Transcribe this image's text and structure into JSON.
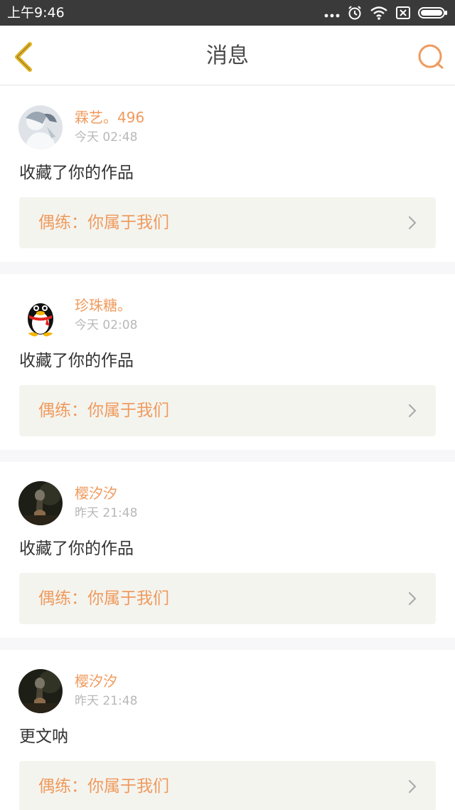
{
  "status_bar": {
    "time": "上午9:46",
    "icons": [
      "more-dots-icon",
      "alarm-icon",
      "wifi-icon",
      "sim-off-icon",
      "battery-icon"
    ]
  },
  "nav": {
    "title": "消息",
    "back_icon": "back-chevron-icon",
    "search_icon": "search-icon"
  },
  "colors": {
    "accent": "#ef9a5d",
    "back_icon": "#e2b322",
    "card_bg": "#f4f4ef",
    "divider_bg": "#f7f6f8"
  },
  "messages": [
    {
      "user": "霖艺。496",
      "time": "今天 02:48",
      "text": "收藏了你的作品",
      "work": "偶练：你属于我们",
      "avatar": "anime-avatar"
    },
    {
      "user": "珍珠糖。",
      "time": "今天 02:08",
      "text": "收藏了你的作品",
      "work": "偶练：你属于我们",
      "avatar": "qq-penguin-avatar"
    },
    {
      "user": "樱汐汐",
      "time": "昨天 21:48",
      "text": "收藏了你的作品",
      "work": "偶练：你属于我们",
      "avatar": "dark-photo-avatar"
    },
    {
      "user": "樱汐汐",
      "time": "昨天 21:48",
      "text": "更文呐",
      "work": "偶练：你属于我们",
      "avatar": "dark-photo-avatar"
    }
  ]
}
